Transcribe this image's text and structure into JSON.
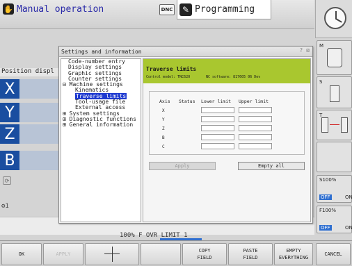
{
  "header": {
    "mode_left": "Manual operation",
    "dnc_label": "DNC",
    "mode_right": "Programming"
  },
  "left_panel": {
    "position_label": "Position displ",
    "axes": [
      "X",
      "Y",
      "Z",
      "B"
    ],
    "icon1": "refresh-icon",
    "icon2_label": "1"
  },
  "strip": {
    "text": "100% F OVR   LIMIT 1"
  },
  "sidebar": {
    "m_label": "M",
    "s_label": "S",
    "t_label": "T",
    "s100": "S100%",
    "f100": "F100%",
    "off": "OFF",
    "on": "ON"
  },
  "dialog": {
    "title": "Settings and information",
    "close": "? ⊠",
    "tree": [
      {
        "label": "Code-number entry",
        "indent": 0
      },
      {
        "label": "Display settings",
        "indent": 0
      },
      {
        "label": "Graphic settings",
        "indent": 0
      },
      {
        "label": "Counter settings",
        "indent": 0
      },
      {
        "label": "⊟ Machine settings",
        "indent": 0
      },
      {
        "label": "Kinematics",
        "indent": 1
      },
      {
        "label": "Traverse limits",
        "indent": 1,
        "selected": true
      },
      {
        "label": "Tool-usage file",
        "indent": 1
      },
      {
        "label": "External access",
        "indent": 1
      },
      {
        "label": "⊞ System settings",
        "indent": 0
      },
      {
        "label": "⊞ Diagnostic functions",
        "indent": 0
      },
      {
        "label": "⊞ General information",
        "indent": 0
      }
    ],
    "detail": {
      "title": "Traverse limits",
      "control_model": "Control model: TNC620",
      "nc_software": "NC software: 817605 06 Dev",
      "headers": {
        "axis": "Axis",
        "status": "Status",
        "lower": "Lower limit",
        "upper": "Upper limit"
      },
      "axes": [
        "X",
        "Y",
        "Z",
        "B",
        "C"
      ],
      "apply": "Apply",
      "empty_all": "Empty all"
    }
  },
  "softkeys": [
    {
      "label": "OK",
      "disabled": false
    },
    {
      "label": "APPLY",
      "disabled": true
    },
    {
      "label": "",
      "disabled": false,
      "icon": "crosshair-icon"
    },
    {
      "label": "",
      "disabled": false
    },
    {
      "label": "COPY\nFIELD",
      "disabled": false
    },
    {
      "label": "PASTE\nFIELD",
      "disabled": false
    },
    {
      "label": "EMPTY\nEVERYTHING",
      "disabled": false
    },
    {
      "label": "CANCEL",
      "disabled": false
    }
  ]
}
